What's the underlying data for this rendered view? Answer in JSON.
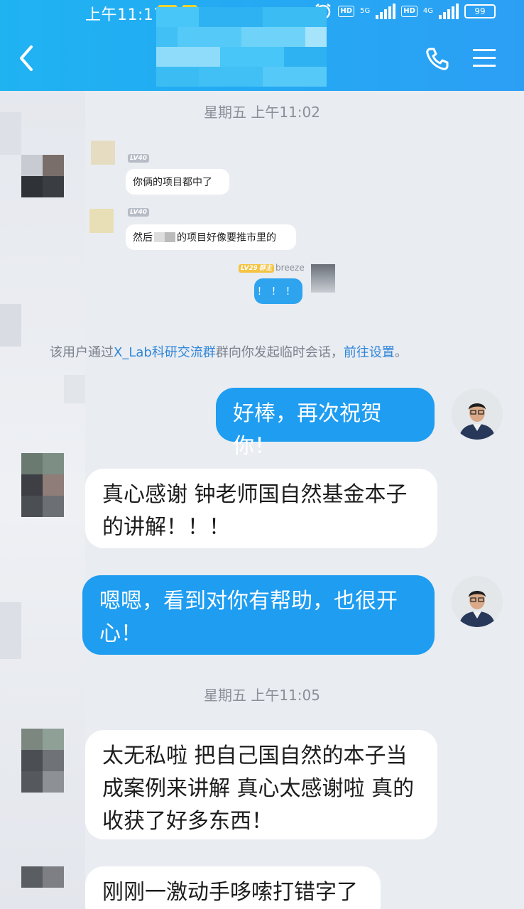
{
  "status_bar": {
    "time": "上午11:17",
    "badge1": "闹钟",
    "badge2": "米",
    "hd1": "HD",
    "net1": "5G",
    "hd2": "HD",
    "net2": "4G",
    "battery": "99"
  },
  "header": {
    "back_icon": "back-arrow",
    "call_icon": "phone-icon",
    "menu_icon": "menu-icon"
  },
  "quoted": {
    "timestamp": "星期五 上午11:02",
    "msg1_level": "LV40",
    "msg1_text": "你俩的项目都中了",
    "msg2_level": "LV40",
    "msg2_text_a": "然后",
    "msg2_text_b": "的项目好像要推市里的",
    "msg3_level": "LV29",
    "msg3_role": "群主",
    "msg3_name": "breeze",
    "msg3_text": "！！！"
  },
  "system_note": {
    "prefix": "该用户通过",
    "group": "X_Lab科研交流群",
    "suffix": "群向你发起临时会话，",
    "link": "前往设置",
    "end": "。"
  },
  "messages": {
    "m1": "好棒，再次祝贺你！",
    "m2_line1": "真心感谢 钟老师国自然基金本子",
    "m2_line2": "的讲解！！！",
    "m3_line1": "嗯嗯，看到对你有帮助，也很开",
    "m3_line2": "心！",
    "timestamp2": "星期五 上午11:05",
    "m4_line1": "太无私啦 把自己国自然的本子当",
    "m4_line2": "成案例来讲解 真心太感谢啦 真的",
    "m4_line3": "收获了好多东西！",
    "m5": "刚刚一激动手哆嗦打错字了"
  },
  "colors": {
    "header": "#25a9f3",
    "bubble_blue": "#1e9df1",
    "bubble_white": "#ffffff",
    "background": "#e9ecf1",
    "link": "#2f86d9"
  }
}
